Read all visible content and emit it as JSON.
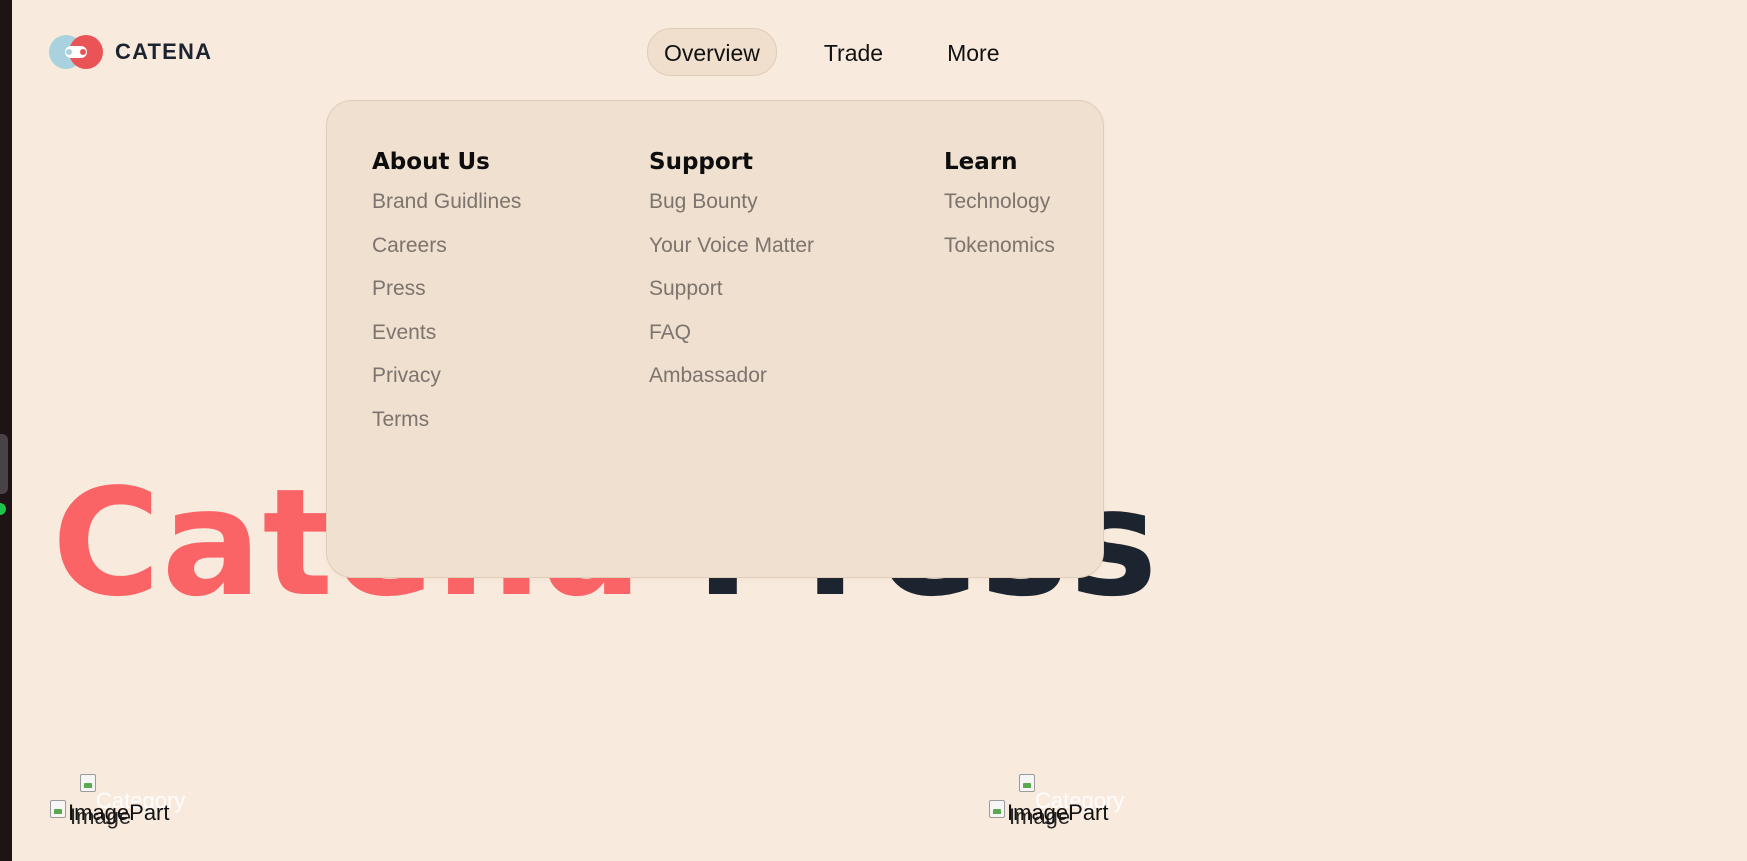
{
  "header": {
    "brand": "CATENA",
    "nav": [
      {
        "label": "Overview",
        "active": true
      },
      {
        "label": "Trade",
        "active": false
      },
      {
        "label": "More",
        "active": false
      }
    ]
  },
  "hero": {
    "title_accent": "Catena",
    "title_rest": "Press"
  },
  "menu": {
    "about": {
      "heading": "About Us",
      "items": [
        "Brand Guidlines",
        "Careers",
        "Press",
        "Events",
        "Privacy",
        "Terms"
      ]
    },
    "support": {
      "heading": "Support",
      "items": [
        "Bug Bounty",
        "Your Voice Matter",
        "Support",
        "FAQ",
        "Ambassador"
      ]
    },
    "learn": {
      "heading": "Learn",
      "items": [
        "Technology",
        "Tokenomics"
      ]
    }
  },
  "cards": [
    {
      "category": "Category",
      "alt_part": "ImagePart",
      "alt_img": "Image"
    },
    {
      "category": "Category",
      "alt_part": "ImagePart",
      "alt_img": "Image"
    }
  ],
  "colors": {
    "background": "#f8eadd",
    "accent": "#fb6467",
    "dark": "#1c2430",
    "menu_bg": "#f0e0cf",
    "muted_link": "#7c746d"
  },
  "icons": {
    "logo": "catena-logo-icon",
    "broken_image": "broken-image-icon"
  }
}
